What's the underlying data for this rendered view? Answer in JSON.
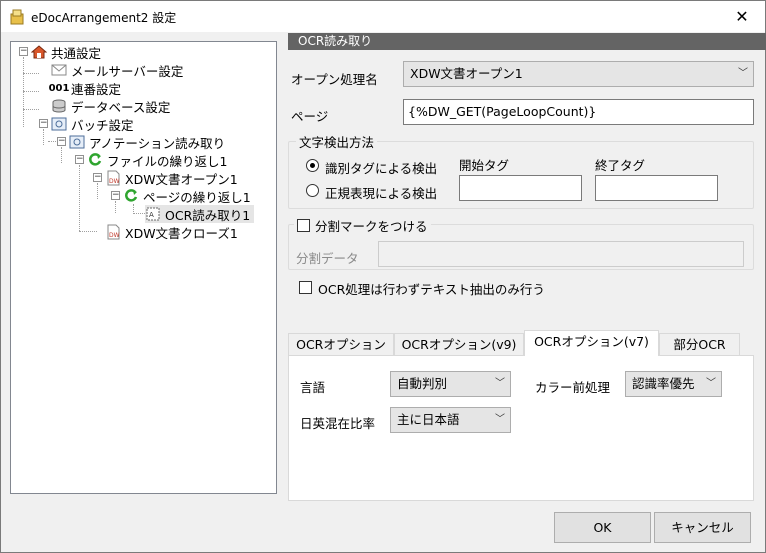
{
  "window": {
    "title": "eDocArrangement2 設定",
    "close": "✕"
  },
  "tree": {
    "items": [
      {
        "label": "共通設定",
        "icon": "house-icon"
      },
      {
        "label": "メールサーバー設定",
        "icon": "mail-icon"
      },
      {
        "label": "連番設定",
        "icon": "serial-number-icon",
        "icon_text": "001"
      },
      {
        "label": "データベース設定",
        "icon": "database-icon"
      },
      {
        "label": "バッチ設定",
        "icon": "batch-icon"
      },
      {
        "label": "アノテーション読み取り",
        "icon": "annotation-icon"
      },
      {
        "label": "ファイルの繰り返し1",
        "icon": "loop-icon"
      },
      {
        "label": "XDW文書オープン1",
        "icon": "xdw-document-icon",
        "icon_text": "DW"
      },
      {
        "label": "ページの繰り返し1",
        "icon": "loop-icon"
      },
      {
        "label": "OCR読み取り1",
        "icon": "ocr-icon"
      },
      {
        "label": "XDW文書クローズ1",
        "icon": "xdw-document-icon",
        "icon_text": "DW"
      }
    ]
  },
  "panel": {
    "header": "OCR読み取り",
    "open_process_label": "オープン処理名",
    "open_process_value": "XDW文書オープン1",
    "page_label": "ページ",
    "page_value": "{%DW_GET(PageLoopCount)}",
    "detect_group": "文字検出方法",
    "radio_tag": "識別タグによる検出",
    "radio_regex": "正規表現による検出",
    "start_tag_label": "開始タグ",
    "end_tag_label": "終了タグ",
    "start_tag_value": "",
    "end_tag_value": "",
    "split_mark_label": "分割マークをつける",
    "split_data_label": "分割データ",
    "split_data_value": "",
    "text_only_label": "OCR処理は行わずテキスト抽出のみ行う",
    "tabs": [
      "OCRオプション",
      "OCRオプション(v9)",
      "OCRオプション(v7)",
      "部分OCR"
    ],
    "language_label": "言語",
    "language_value": "自動判別",
    "color_label": "カラー前処理",
    "color_value": "認識率優先",
    "ratio_label": "日英混在比率",
    "ratio_value": "主に日本語"
  },
  "buttons": {
    "ok": "OK",
    "cancel": "キャンセル"
  }
}
